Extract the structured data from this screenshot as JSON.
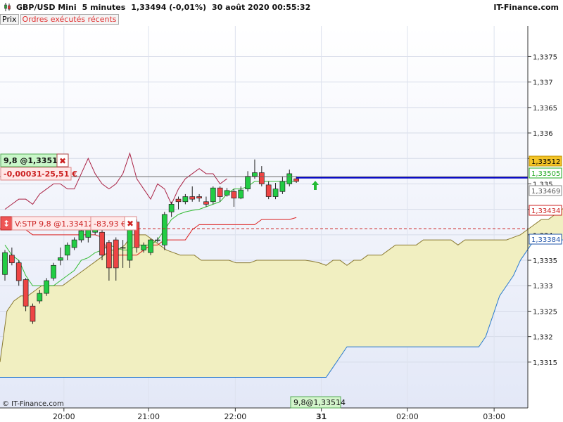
{
  "header": {
    "instrument": "GBP/USD Mini",
    "interval": "5 minutes",
    "last": "1,33494 (-0,01%)",
    "datetime": "30 août 2020 00:55:32",
    "brand": "IT-Finance.com"
  },
  "tabs": [
    "Prix",
    "Ordres exécutés récents"
  ],
  "copyright": "© IT-Finance.com",
  "colors": {
    "up": "#22cc44",
    "down": "#ee4444",
    "tenkan": "#33bb33",
    "kijun": "#dd2222",
    "span_a": "#8a7a30",
    "span_b": "#2a7ad0",
    "cloud": "#f1efc1",
    "price_line": "#0000cc",
    "chikou": "#aa2244"
  },
  "position_panel": {
    "qty_price": "9,8 @1,33514",
    "pnl_points": "-0,00031",
    "pnl_money": "-25,51 €"
  },
  "stop_panel": {
    "label": "V:STP  9,8 @1,33412",
    "pnl_money": "-83,93 €"
  },
  "bottom_marker": "9,8@1,33514",
  "price_tags": [
    {
      "value": "1,33512",
      "bg": "#f3c428",
      "fg": "#000000",
      "border": "#c09000"
    },
    {
      "value": "1,33505",
      "bg": "#ffffff",
      "fg": "#22aa22",
      "border": "#22aa22"
    },
    {
      "value": "1,33469",
      "bg": "#ffffff",
      "fg": "#555555",
      "border": "#888888"
    },
    {
      "value": "1,33434",
      "bg": "#ffffff",
      "fg": "#cc2222",
      "border": "#cc2222"
    },
    {
      "value": "1,33384",
      "bg": "#ffffff",
      "fg": "#2255aa",
      "border": "#2255aa"
    }
  ],
  "chart_data": {
    "type": "candlestick",
    "y_axis": {
      "range": [
        1.3306,
        1.3381
      ],
      "ticks": [
        "1,3375",
        "1,337",
        "1,3365",
        "1,336",
        "1,3355",
        "1,335",
        "1,3345",
        "1,334",
        "1,3335",
        "1,333",
        "1,3325",
        "1,332",
        "1,3315"
      ]
    },
    "x_axis": {
      "ticks": [
        "20:00",
        "21:00",
        "22:00",
        "31",
        "02:00",
        "03:00"
      ]
    },
    "candles": [
      [
        1.33322,
        1.33365,
        1.3331,
        1.3337
      ],
      [
        1.3336,
        1.33345,
        1.3334,
        1.33375
      ],
      [
        1.33345,
        1.3331,
        1.333,
        1.3335
      ],
      [
        1.33312,
        1.3326,
        1.3325,
        1.33315
      ],
      [
        1.3326,
        1.3323,
        1.33225,
        1.33265
      ],
      [
        1.3327,
        1.33285,
        1.33265,
        1.33292
      ],
      [
        1.33285,
        1.3331,
        1.3328,
        1.33315
      ],
      [
        1.33315,
        1.3334,
        1.3331,
        1.33345
      ],
      [
        1.3335,
        1.33355,
        1.3334,
        1.33375
      ],
      [
        1.3336,
        1.3338,
        1.3335,
        1.33385
      ],
      [
        1.33375,
        1.3339,
        1.3337,
        1.33395
      ],
      [
        1.3339,
        1.33408,
        1.33385,
        1.33415
      ],
      [
        1.33395,
        1.33415,
        1.33385,
        1.3342
      ],
      [
        1.33405,
        1.3341,
        1.334,
        1.33422
      ],
      [
        1.33405,
        1.3336,
        1.3335,
        1.3341
      ],
      [
        1.33385,
        1.33335,
        1.3331,
        1.3339
      ],
      [
        1.3339,
        1.33335,
        1.3331,
        1.33395
      ],
      [
        1.33375,
        1.33375,
        1.33335,
        1.3339
      ],
      [
        1.3335,
        1.33425,
        1.33335,
        1.33428
      ],
      [
        1.33425,
        1.33375,
        1.33365,
        1.3343
      ],
      [
        1.3337,
        1.3338,
        1.33365,
        1.33385
      ],
      [
        1.33365,
        1.3339,
        1.3336,
        1.33392
      ],
      [
        1.3339,
        1.3339,
        1.33385,
        1.33395
      ],
      [
        1.3338,
        1.3344,
        1.3337,
        1.33445
      ],
      [
        1.33445,
        1.3346,
        1.33435,
        1.33465
      ],
      [
        1.3347,
        1.33465,
        1.3345,
        1.33475
      ],
      [
        1.33465,
        1.33475,
        1.3346,
        1.3348
      ],
      [
        1.33475,
        1.3347,
        1.33465,
        1.33495
      ],
      [
        1.33475,
        1.33472,
        1.33465,
        1.3348
      ],
      [
        1.33465,
        1.3346,
        1.33455,
        1.33475
      ],
      [
        1.33465,
        1.33492,
        1.3346,
        1.33495
      ],
      [
        1.33492,
        1.33475,
        1.33465,
        1.33495
      ],
      [
        1.33478,
        1.33487,
        1.33475,
        1.33492
      ],
      [
        1.33485,
        1.33472,
        1.33455,
        1.3349
      ],
      [
        1.33472,
        1.33488,
        1.3347,
        1.33495
      ],
      [
        1.3349,
        1.33515,
        1.33485,
        1.33525
      ],
      [
        1.33515,
        1.33522,
        1.3351,
        1.33548
      ],
      [
        1.33522,
        1.335,
        1.33495,
        1.33535
      ],
      [
        1.33498,
        1.33475,
        1.3347,
        1.33505
      ],
      [
        1.33475,
        1.3349,
        1.3347,
        1.33502
      ],
      [
        1.33485,
        1.33505,
        1.3348,
        1.33515
      ],
      [
        1.335,
        1.3352,
        1.33495,
        1.33528
      ],
      [
        1.3351,
        1.33505,
        1.33502,
        1.33515
      ]
    ],
    "tenkan": [
      1.3338,
      1.3336,
      1.3335,
      1.3332,
      1.333,
      1.333,
      1.333,
      1.333,
      1.3331,
      1.3332,
      1.3333,
      1.3335,
      1.33355,
      1.33365,
      1.3337,
      1.3338,
      1.33375,
      1.3337,
      1.3337,
      1.3338,
      1.3338,
      1.3338,
      1.3339,
      1.3341,
      1.3343,
      1.3344,
      1.33445,
      1.33448,
      1.3345,
      1.33455,
      1.3346,
      1.33465,
      1.3348,
      1.3349,
      1.3349,
      1.33495,
      1.33505,
      1.33505,
      1.33505,
      1.33505,
      1.33505,
      1.33505,
      1.33505
    ],
    "kijun": [
      1.3342,
      1.3342,
      1.3341,
      1.3341,
      1.334,
      1.334,
      1.334,
      1.334,
      1.334,
      1.334,
      1.334,
      1.334,
      1.334,
      1.334,
      1.33395,
      1.3336,
      1.3336,
      1.3336,
      1.3336,
      1.3336,
      1.3337,
      1.3338,
      1.3338,
      1.3339,
      1.3339,
      1.3339,
      1.3339,
      1.3341,
      1.3342,
      1.3342,
      1.3342,
      1.3342,
      1.3342,
      1.3342,
      1.3342,
      1.3342,
      1.3342,
      1.3343,
      1.3343,
      1.3343,
      1.3343,
      1.3343,
      1.33434
    ],
    "chikou": [
      1.3345,
      1.3346,
      1.3347,
      1.3347,
      1.3346,
      1.3348,
      1.3349,
      1.335,
      1.335,
      1.3349,
      1.3349,
      1.3352,
      1.3355,
      1.3352,
      1.335,
      1.3349,
      1.335,
      1.3352,
      1.3356,
      1.3351,
      1.3349,
      1.3347,
      1.335,
      1.3349,
      1.3346,
      1.3349,
      1.3351,
      1.3352,
      1.3353,
      1.3352,
      1.3352,
      1.335,
      1.3351
    ],
    "span_a": [
      1.3315,
      1.3325,
      1.3327,
      1.3328,
      1.3328,
      1.3329,
      1.333,
      1.333,
      1.333,
      1.333,
      1.3331,
      1.3332,
      1.3333,
      1.3334,
      1.3335,
      1.3336,
      1.3337,
      1.3337,
      1.3338,
      1.334,
      1.334,
      1.334,
      1.3339,
      1.3338,
      1.3337,
      1.33365,
      1.3336,
      1.3336,
      1.3336,
      1.3335,
      1.3335,
      1.3335,
      1.3335,
      1.3335,
      1.33345,
      1.33345,
      1.33345,
      1.3335,
      1.3335,
      1.3335,
      1.3335,
      1.3335,
      1.3335,
      1.3335,
      1.3335,
      1.33348,
      1.33345,
      1.3334,
      1.3335,
      1.3335,
      1.3334,
      1.3335,
      1.3335,
      1.3336,
      1.3336,
      1.3336,
      1.3337,
      1.3338,
      1.3338,
      1.3338,
      1.3338,
      1.3339,
      1.3339,
      1.3339,
      1.3339,
      1.3339,
      1.3338,
      1.3339,
      1.3339,
      1.3339,
      1.3339,
      1.3339,
      1.3339,
      1.3339,
      1.33395,
      1.334,
      1.3341,
      1.3342,
      1.3343,
      1.3343,
      1.3344,
      1.3345,
      1.3346,
      1.3346,
      1.3346,
      1.3346,
      1.33465,
      1.33465,
      1.33465,
      1.33465,
      1.33465,
      1.33465,
      1.33468,
      1.33469
    ],
    "span_b": [
      1.3312,
      1.3312,
      1.3312,
      1.3312,
      1.3312,
      1.3312,
      1.3312,
      1.3312,
      1.3312,
      1.3312,
      1.3312,
      1.3312,
      1.3312,
      1.3312,
      1.3312,
      1.3312,
      1.3312,
      1.3312,
      1.3312,
      1.3312,
      1.3312,
      1.3312,
      1.3312,
      1.3312,
      1.3312,
      1.3312,
      1.3312,
      1.3312,
      1.3312,
      1.3312,
      1.3312,
      1.3312,
      1.3312,
      1.3312,
      1.3312,
      1.3312,
      1.3312,
      1.3312,
      1.3312,
      1.3312,
      1.3312,
      1.3312,
      1.3312,
      1.3312,
      1.3312,
      1.3312,
      1.3312,
      1.3312,
      1.3314,
      1.3316,
      1.3318,
      1.3318,
      1.3318,
      1.3318,
      1.3318,
      1.3318,
      1.3318,
      1.3318,
      1.3318,
      1.3318,
      1.3318,
      1.3318,
      1.3318,
      1.3318,
      1.3318,
      1.3318,
      1.3318,
      1.3318,
      1.3318,
      1.3318,
      1.332,
      1.3324,
      1.3328,
      1.333,
      1.3332,
      1.3335,
      1.3337,
      1.3339,
      1.3339,
      1.3339,
      1.3339,
      1.3339,
      1.3339,
      1.3339,
      1.3339,
      1.3338,
      1.3338,
      1.3338,
      1.33375,
      1.3337,
      1.3337,
      1.3337,
      1.3337,
      1.3337,
      1.3337,
      1.3337,
      1.3337,
      1.3337,
      1.3338,
      1.3338,
      1.33384,
      1.33384,
      1.33384,
      1.33384,
      1.33384,
      1.33384,
      1.33384,
      1.33384,
      1.33384,
      1.33384,
      1.33384
    ]
  }
}
